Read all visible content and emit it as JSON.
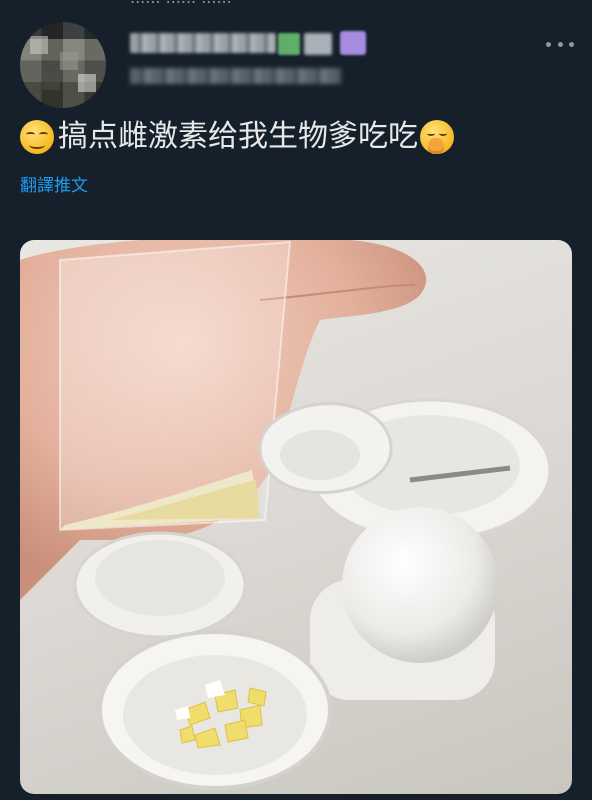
{
  "header": {
    "partial_top_text": "...... ...... ......"
  },
  "tweet": {
    "text": "搞点雌激素给我生物爹吃吃",
    "translate_label": "翻譯推文"
  },
  "icons": {
    "more": "more-horizontal-icon",
    "leading_emoji": "smirking-face-emoji",
    "trailing_emoji": "yawning-face-emoji"
  },
  "colors": {
    "background": "#15202b",
    "text": "#e7e9ea",
    "link": "#1d9bf0",
    "muted": "#8b98a5"
  }
}
